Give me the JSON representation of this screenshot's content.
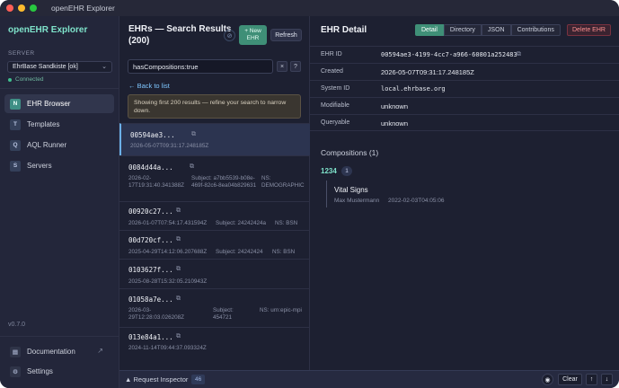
{
  "window": {
    "title": "openEHR Explorer"
  },
  "sidebar": {
    "brand": "openEHR Explorer",
    "server_label": "SERVER",
    "server_value": "EhrBase Sandkiste [ok]",
    "status": "Connected",
    "nav": [
      {
        "icon": "N",
        "label": "EHR Browser"
      },
      {
        "icon": "T",
        "label": "Templates"
      },
      {
        "icon": "Q",
        "label": "AQL Runner"
      },
      {
        "icon": "S",
        "label": "Servers"
      }
    ],
    "version": "v0.7.0",
    "footer": [
      {
        "label": "Documentation"
      },
      {
        "label": "Settings"
      }
    ]
  },
  "results": {
    "title": "EHRs — Search Results (200)",
    "new_button": "+ New EHR",
    "refresh_button": "Refresh",
    "search_value": "hasCompositions:true",
    "back_link": "← Back to list",
    "notice": "Showing first 200 results — refine your search to narrow down.",
    "rows": [
      {
        "id": "00594ae3...",
        "date": "2026-05-07T09:31:17.248185Z",
        "subject": "",
        "ns": ""
      },
      {
        "id": "0084d44a...",
        "date": "2026-02-17T19:31:40.341388Z",
        "subject": "Subject: a7bb5539-b08e-469f-82c6-8ea04b829631",
        "ns": "NS: DEMOGRAPHIC"
      },
      {
        "id": "00920c27...",
        "date": "2026-01-07T07:54:17.431594Z",
        "subject": "Subject: 24242424a",
        "ns": "NS: BSN"
      },
      {
        "id": "00d720cf...",
        "date": "2025-04-29T14:12:06.207688Z",
        "subject": "Subject: 24242424",
        "ns": "NS: BSN"
      },
      {
        "id": "0103627f...",
        "date": "2025-08-28T15:32:05.210943Z",
        "subject": "",
        "ns": ""
      },
      {
        "id": "01058a7e...",
        "date": "2026-03-29T12:28:03.026208Z",
        "subject": "Subject: 454721",
        "ns": "NS: urn:epic-mpi"
      },
      {
        "id": "013e84a1...",
        "date": "2024-11-14T09:44:37.093324Z",
        "subject": "",
        "ns": ""
      }
    ]
  },
  "detail": {
    "title": "EHR Detail",
    "tabs": [
      "Detail",
      "Directory",
      "JSON",
      "Contributions"
    ],
    "delete_button": "Delete EHR",
    "fields": [
      {
        "key": "EHR ID",
        "value": "00594ae3-4199-4cc7-a966-60801a252483"
      },
      {
        "key": "Created",
        "value": "2026-05-07T09:31:17.248185Z"
      },
      {
        "key": "System ID",
        "value": "local.ehrbase.org"
      },
      {
        "key": "Modifiable",
        "value": "unknown"
      },
      {
        "key": "Queryable",
        "value": "unknown"
      }
    ],
    "compositions_title": "Compositions (1)",
    "group_name": "1234",
    "group_count": "1",
    "composition": {
      "name": "Vital Signs",
      "author": "Max Mustermann",
      "date": "2022-02-03T04:05:06"
    }
  },
  "bottom": {
    "label": "Request Inspector",
    "count": "46",
    "clear": "Clear"
  },
  "colors": {
    "accent": "#7fe3cb",
    "primary_button": "#3f8f77",
    "danger": "#ff8f8f",
    "link": "#7fc7ff"
  }
}
